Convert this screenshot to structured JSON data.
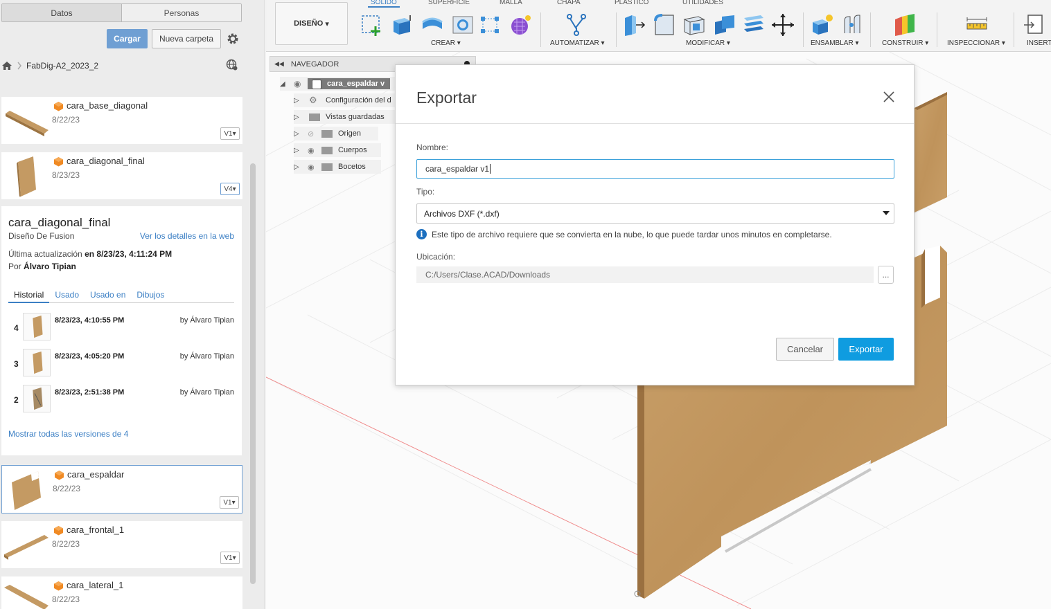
{
  "left_panel": {
    "tabs": [
      "Datos",
      "Personas"
    ],
    "upload_label": "Cargar",
    "new_folder_label": "Nueva carpeta",
    "project": "FabDig-A2_2023_2",
    "files": [
      {
        "name": "cara_base_diagonal",
        "date": "8/22/23",
        "version": "V1"
      },
      {
        "name": "cara_diagonal_final",
        "date": "8/23/23",
        "version": "V4"
      },
      {
        "name": "cara_espaldar",
        "date": "8/22/23",
        "version": "V1"
      },
      {
        "name": "cara_frontal_1",
        "date": "8/22/23",
        "version": "V1"
      },
      {
        "name": "cara_lateral_1",
        "date": "8/22/23",
        "version": ""
      }
    ],
    "details": {
      "title": "cara_diagonal_final",
      "type": "Diseño De Fusion",
      "web_link": "Ver los detalles en la web",
      "updated_prefix": "Última actualización",
      "updated_value": "en 8/23/23, 4:11:24 PM",
      "by_prefix": "Por",
      "by_value": "Álvaro Tipian",
      "tabs": [
        "Historial",
        "Usado",
        "Usado en",
        "Dibujos"
      ],
      "history": [
        {
          "num": "4",
          "time": "8/23/23, 4:10:55 PM",
          "by": "by Álvaro Tipian"
        },
        {
          "num": "3",
          "time": "8/23/23, 4:05:20 PM",
          "by": "by Álvaro Tipian"
        },
        {
          "num": "2",
          "time": "8/23/23, 2:51:38 PM",
          "by": "by Álvaro Tipian"
        }
      ],
      "show_all": "Mostrar todas las versiones de 4"
    }
  },
  "toolbar": {
    "workspace": "DISEÑO",
    "tabs": [
      "SÓLIDO",
      "SUPERFICIE",
      "MALLA",
      "CHAPA",
      "PLÁSTICO",
      "UTILIDADES"
    ],
    "groups": [
      "CREAR",
      "AUTOMATIZAR",
      "MODIFICAR",
      "ENSAMBLAR",
      "CONSTRUIR",
      "INSPECCIONAR",
      "INSERT"
    ]
  },
  "navigator": {
    "title": "NAVEGADOR",
    "root": "cara_espaldar v",
    "items": [
      "Configuración del d",
      "Vistas guardadas",
      "Origen",
      "Cuerpos",
      "Bocetos"
    ]
  },
  "dialog": {
    "title": "Exportar",
    "name_label": "Nombre:",
    "name_value": "cara_espaldar v1",
    "type_label": "Tipo:",
    "type_value": "Archivos DXF (*.dxf)",
    "info_text": "Este tipo de archivo requiere que se convierta en la nube, lo que puede tardar unos minutos en completarse.",
    "location_label": "Ubicación:",
    "location_value": "C:/Users/Clase.ACAD/Downloads",
    "browse_label": "...",
    "cancel_label": "Cancelar",
    "export_label": "Exportar"
  },
  "colors": {
    "accent": "#0f9ce0",
    "link": "#3b7fc4",
    "wood": "#c49a63"
  }
}
